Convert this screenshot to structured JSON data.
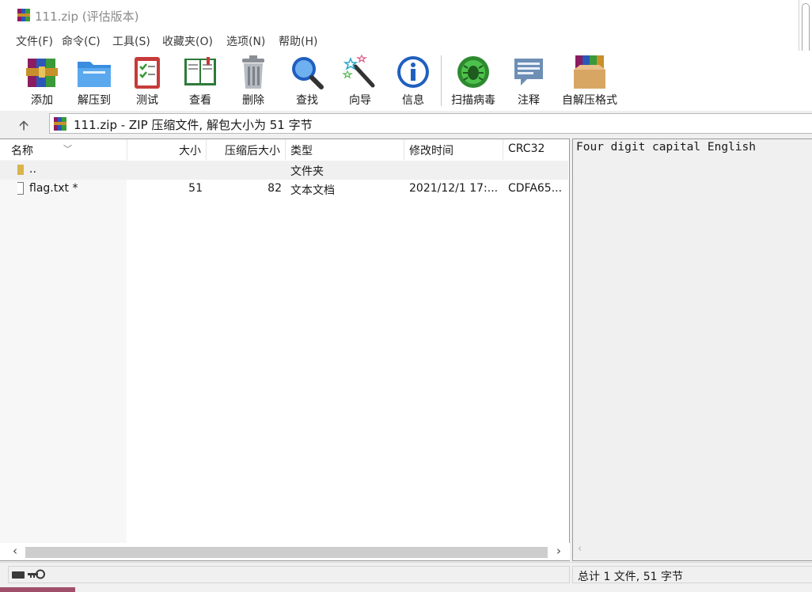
{
  "window": {
    "title": "111.zip (评估版本)"
  },
  "menu": {
    "items": [
      "文件(F)",
      "命令(C)",
      "工具(S)",
      "收藏夹(O)",
      "选项(N)",
      "帮助(H)"
    ]
  },
  "toolbar": {
    "buttons": [
      {
        "label": "添加",
        "icon": "add-archive-icon"
      },
      {
        "label": "解压到",
        "icon": "extract-to-icon"
      },
      {
        "label": "测试",
        "icon": "test-icon"
      },
      {
        "label": "查看",
        "icon": "view-book-icon"
      },
      {
        "label": "删除",
        "icon": "trash-icon"
      },
      {
        "label": "查找",
        "icon": "magnifier-icon"
      },
      {
        "label": "向导",
        "icon": "wizard-wand-icon"
      },
      {
        "label": "信息",
        "icon": "info-icon"
      },
      {
        "label": "扫描病毒",
        "icon": "virus-scan-icon"
      },
      {
        "label": "注释",
        "icon": "comment-icon"
      },
      {
        "label": "自解压格式",
        "icon": "sfx-box-icon"
      }
    ]
  },
  "path": {
    "text": "111.zip - ZIP 压缩文件, 解包大小为 51 字节"
  },
  "columns": {
    "name": "名称",
    "size": "大小",
    "packed": "压缩后大小",
    "type": "类型",
    "modified": "修改时间",
    "crc": "CRC32"
  },
  "rows": [
    {
      "name": "..",
      "size": "",
      "packed": "",
      "type": "文件夹",
      "modified": "",
      "crc": ""
    },
    {
      "name": "flag.txt *",
      "size": "51",
      "packed": "82",
      "type": "文本文档",
      "modified": "2021/12/1 17:...",
      "crc": "CDFA65..."
    }
  ],
  "preview": {
    "text": "Four digit capital English"
  },
  "status": {
    "summary": "总计 1 文件, 51 字节"
  },
  "colors": {
    "accent_folder": "#d9b44a",
    "window_bg": "#f0f0f0"
  }
}
